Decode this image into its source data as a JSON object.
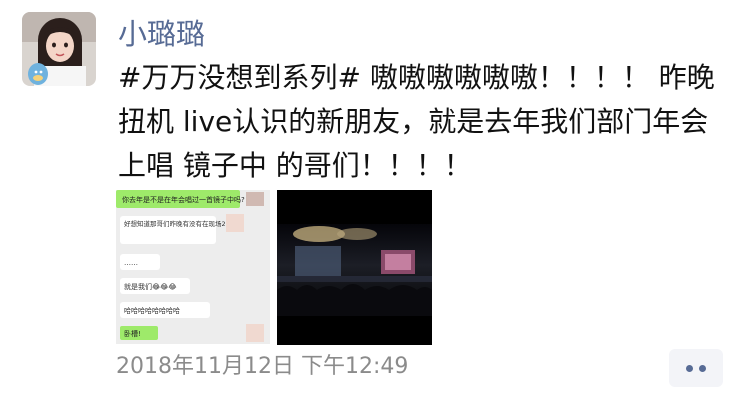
{
  "post": {
    "author_name": "小璐璐",
    "text": "#万万没想到系列# 嗷嗷嗷嗷嗷嗷！！！！ 昨晚扭机 live认识的新朋友，就是去年我们部门年会上唱 镜子中 的哥们！！！！",
    "timestamp": "2018年11月12日 下午12:49"
  },
  "chat_screenshot": {
    "messages": [
      "你去年是不是在年会唱过一首镜子中吗?",
      "好想知道那哥们昨晚有没有在现场2333",
      "……",
      "就是我们😂😂😂",
      "哈哈哈哈哈哈哈哈",
      "卧槽!"
    ]
  },
  "colors": {
    "author": "#576b95",
    "timestamp": "#8b8b8b",
    "chat_green": "#9eea6a",
    "chat_bg": "#ededed"
  },
  "icons": {
    "more": "more-dots-icon"
  }
}
